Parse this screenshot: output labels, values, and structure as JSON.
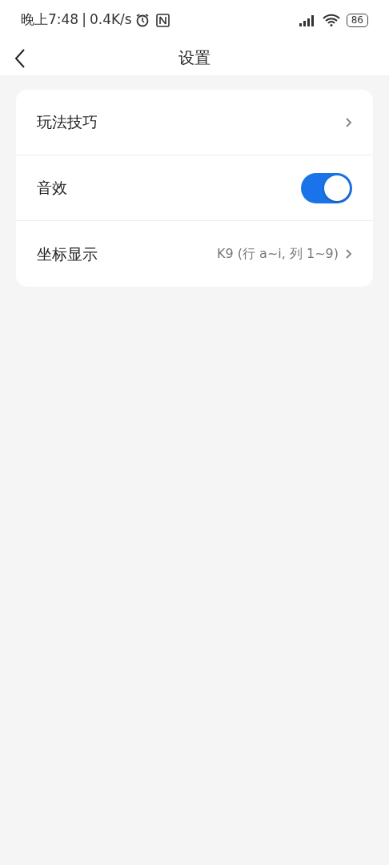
{
  "status_bar": {
    "time": "晚上7:48",
    "separator": "|",
    "speed": "0.4K/s",
    "battery": "86"
  },
  "header": {
    "title": "设置"
  },
  "settings": [
    {
      "kind": "link",
      "label": "玩法技巧"
    },
    {
      "kind": "toggle",
      "label": "音效",
      "on": true
    },
    {
      "kind": "link",
      "label": "坐标显示",
      "value": "K9 (行 a~i, 列 1~9)"
    }
  ]
}
